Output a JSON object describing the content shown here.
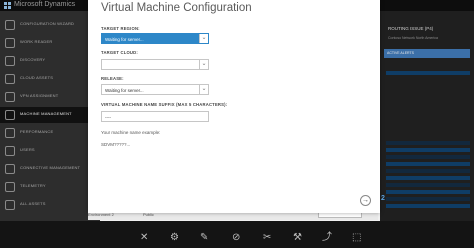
{
  "app": {
    "brand": "Microsoft Dynamics"
  },
  "sidebar": {
    "items": [
      {
        "label": "CONFIGURATION WIZARD",
        "icon": "home-icon"
      },
      {
        "label": "WORK READER",
        "icon": "reader-icon"
      },
      {
        "label": "DISCOVERY",
        "icon": "cloud-icon"
      },
      {
        "label": "CLOUD ASSETS",
        "icon": "cloud-assets-icon"
      },
      {
        "label": "VPN ASSIGNMENT",
        "icon": "vpn-icon"
      },
      {
        "label": "MACHINE MANAGEMENT",
        "icon": "monitor-icon",
        "active": true
      },
      {
        "label": "PERFORMANCE",
        "icon": "performance-icon"
      },
      {
        "label": "USERS",
        "icon": "users-icon"
      },
      {
        "label": "CONNECTIVE MANAGEMENT",
        "icon": "connect-icon"
      },
      {
        "label": "TELEMETRY",
        "icon": "telemetry-icon"
      },
      {
        "label": "ALL ASSETS",
        "icon": "assets-icon"
      }
    ]
  },
  "right_panel": {
    "title": "ROUTING ISSUE (P4)",
    "subtitle": "Contoso Network North America",
    "box_label": "ACTIVE ALERTS"
  },
  "bottom_row": {
    "col_a": "Environment 2",
    "col_b": "Public"
  },
  "dialog": {
    "title": "Virtual Machine Configuration",
    "target_region_label": "TARGET REGION:",
    "target_region_value": "Waiting for server...",
    "target_cloud_label": "TARGET CLOUD:",
    "target_cloud_value": "",
    "release_label": "RELEASE:",
    "release_value": "Waiting for server...",
    "suffix_label": "VIRTUAL MACHINE NAME SUFFIX (MAX 5 CHARACTERS):",
    "suffix_value": "----",
    "example_label": "Your machine name example:",
    "example_value": "SDVM?????...",
    "next_icon": "arrow-right-icon",
    "page_number": "2"
  },
  "colors": {
    "accent": "#2d87c8",
    "sidebar_bg": "#2d2d2d",
    "dialog_bg": "#ffffff"
  }
}
